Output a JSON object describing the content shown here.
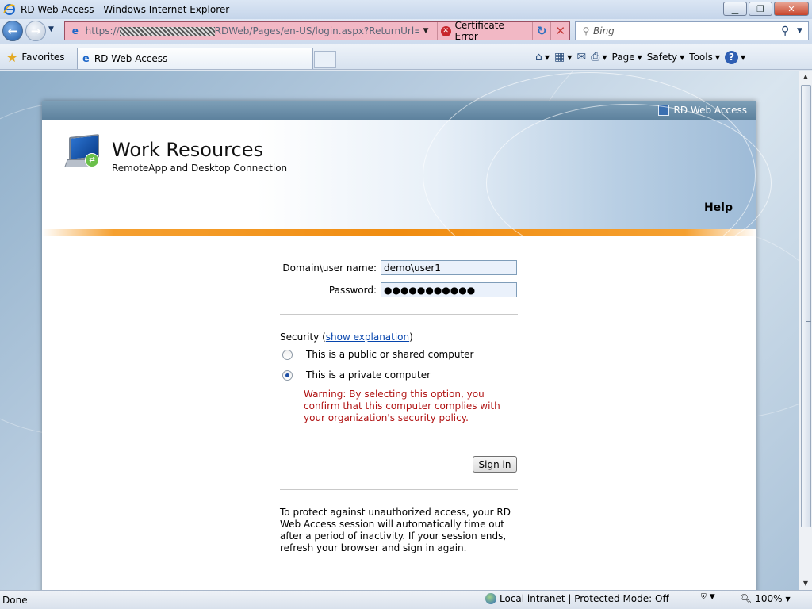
{
  "window": {
    "title": "RD Web Access - Windows Internet Explorer",
    "minimize": "▁",
    "maximize": "❐",
    "close": "✕"
  },
  "address_bar": {
    "url_prefix": "https://",
    "url_suffix": "RDWeb/Pages/en-US/login.aspx?ReturnUrl=/RDWe",
    "certificate_error": "Certificate Error"
  },
  "search": {
    "placeholder": "Bing"
  },
  "favorites_bar": {
    "favorites_label": "Favorites",
    "tab_title": "RD Web Access"
  },
  "command_bar": {
    "page": "Page",
    "safety": "Safety",
    "tools": "Tools"
  },
  "panel": {
    "top_label": "RD Web Access",
    "title": "Work Resources",
    "subtitle": "RemoteApp and Desktop Connection",
    "help": "Help"
  },
  "form": {
    "username_label": "Domain\\user name:",
    "username_value": "demo\\user1",
    "password_label": "Password:",
    "password_value": "●●●●●●●●●●●",
    "security_label": "Security (",
    "security_link": "show explanation",
    "security_close": ")",
    "radio_public": "This is a public or shared computer",
    "radio_private": "This is a private computer",
    "warning": "Warning: By selecting this option, you confirm that this computer complies with your organization's security policy.",
    "signin": "Sign in",
    "notice": "To protect against unauthorized access, your RD Web Access session will automatically time out after a period of inactivity. If your session ends, refresh your browser and sign in again."
  },
  "status_bar": {
    "done": "Done",
    "zone": "Local intranet | Protected Mode: Off",
    "zoom": "100%"
  }
}
